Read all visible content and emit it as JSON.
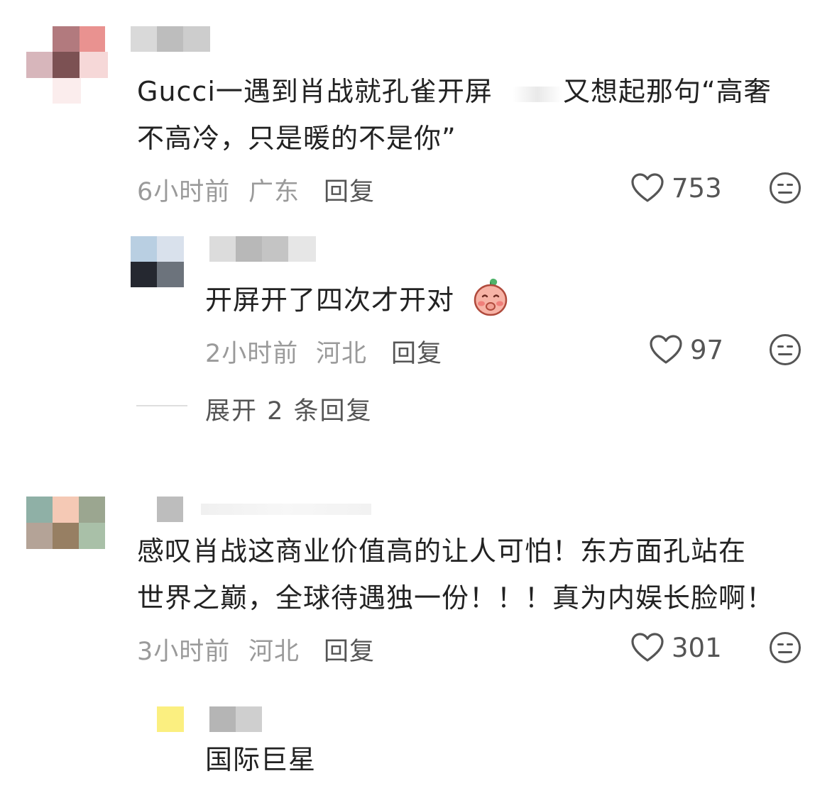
{
  "comments": [
    {
      "text_line1": "Gucci一遇到肖战就孔雀开屏",
      "text_line1b": "又想起那句“高奢",
      "text_line2": "不高冷，只是暖的不是你”",
      "time": "6小时前",
      "location": "广东",
      "reply_label": "回复",
      "likes": "753",
      "replies": [
        {
          "text": "开屏开了四次才开对",
          "emoji": "blushing-peach-emoji",
          "time": "2小时前",
          "location": "河北",
          "reply_label": "回复",
          "likes": "97"
        }
      ],
      "expand_label": "展开 2 条回复"
    },
    {
      "text_line1": "感叹肖战这商业价值高的让人可怕！东方面孔站在",
      "text_line2": "世界之巅，全球待遇独一份！！！真为内娱长脸啊！",
      "time": "3小时前",
      "location": "河北",
      "reply_label": "回复",
      "likes": "301",
      "replies": [
        {
          "text": "国际巨星"
        }
      ]
    }
  ],
  "icons": {
    "like": "heart-outline-icon",
    "dislike": "neutral-face-icon"
  },
  "colors": {
    "text": "#222222",
    "meta": "#9a9a9a",
    "icon": "#555555"
  }
}
